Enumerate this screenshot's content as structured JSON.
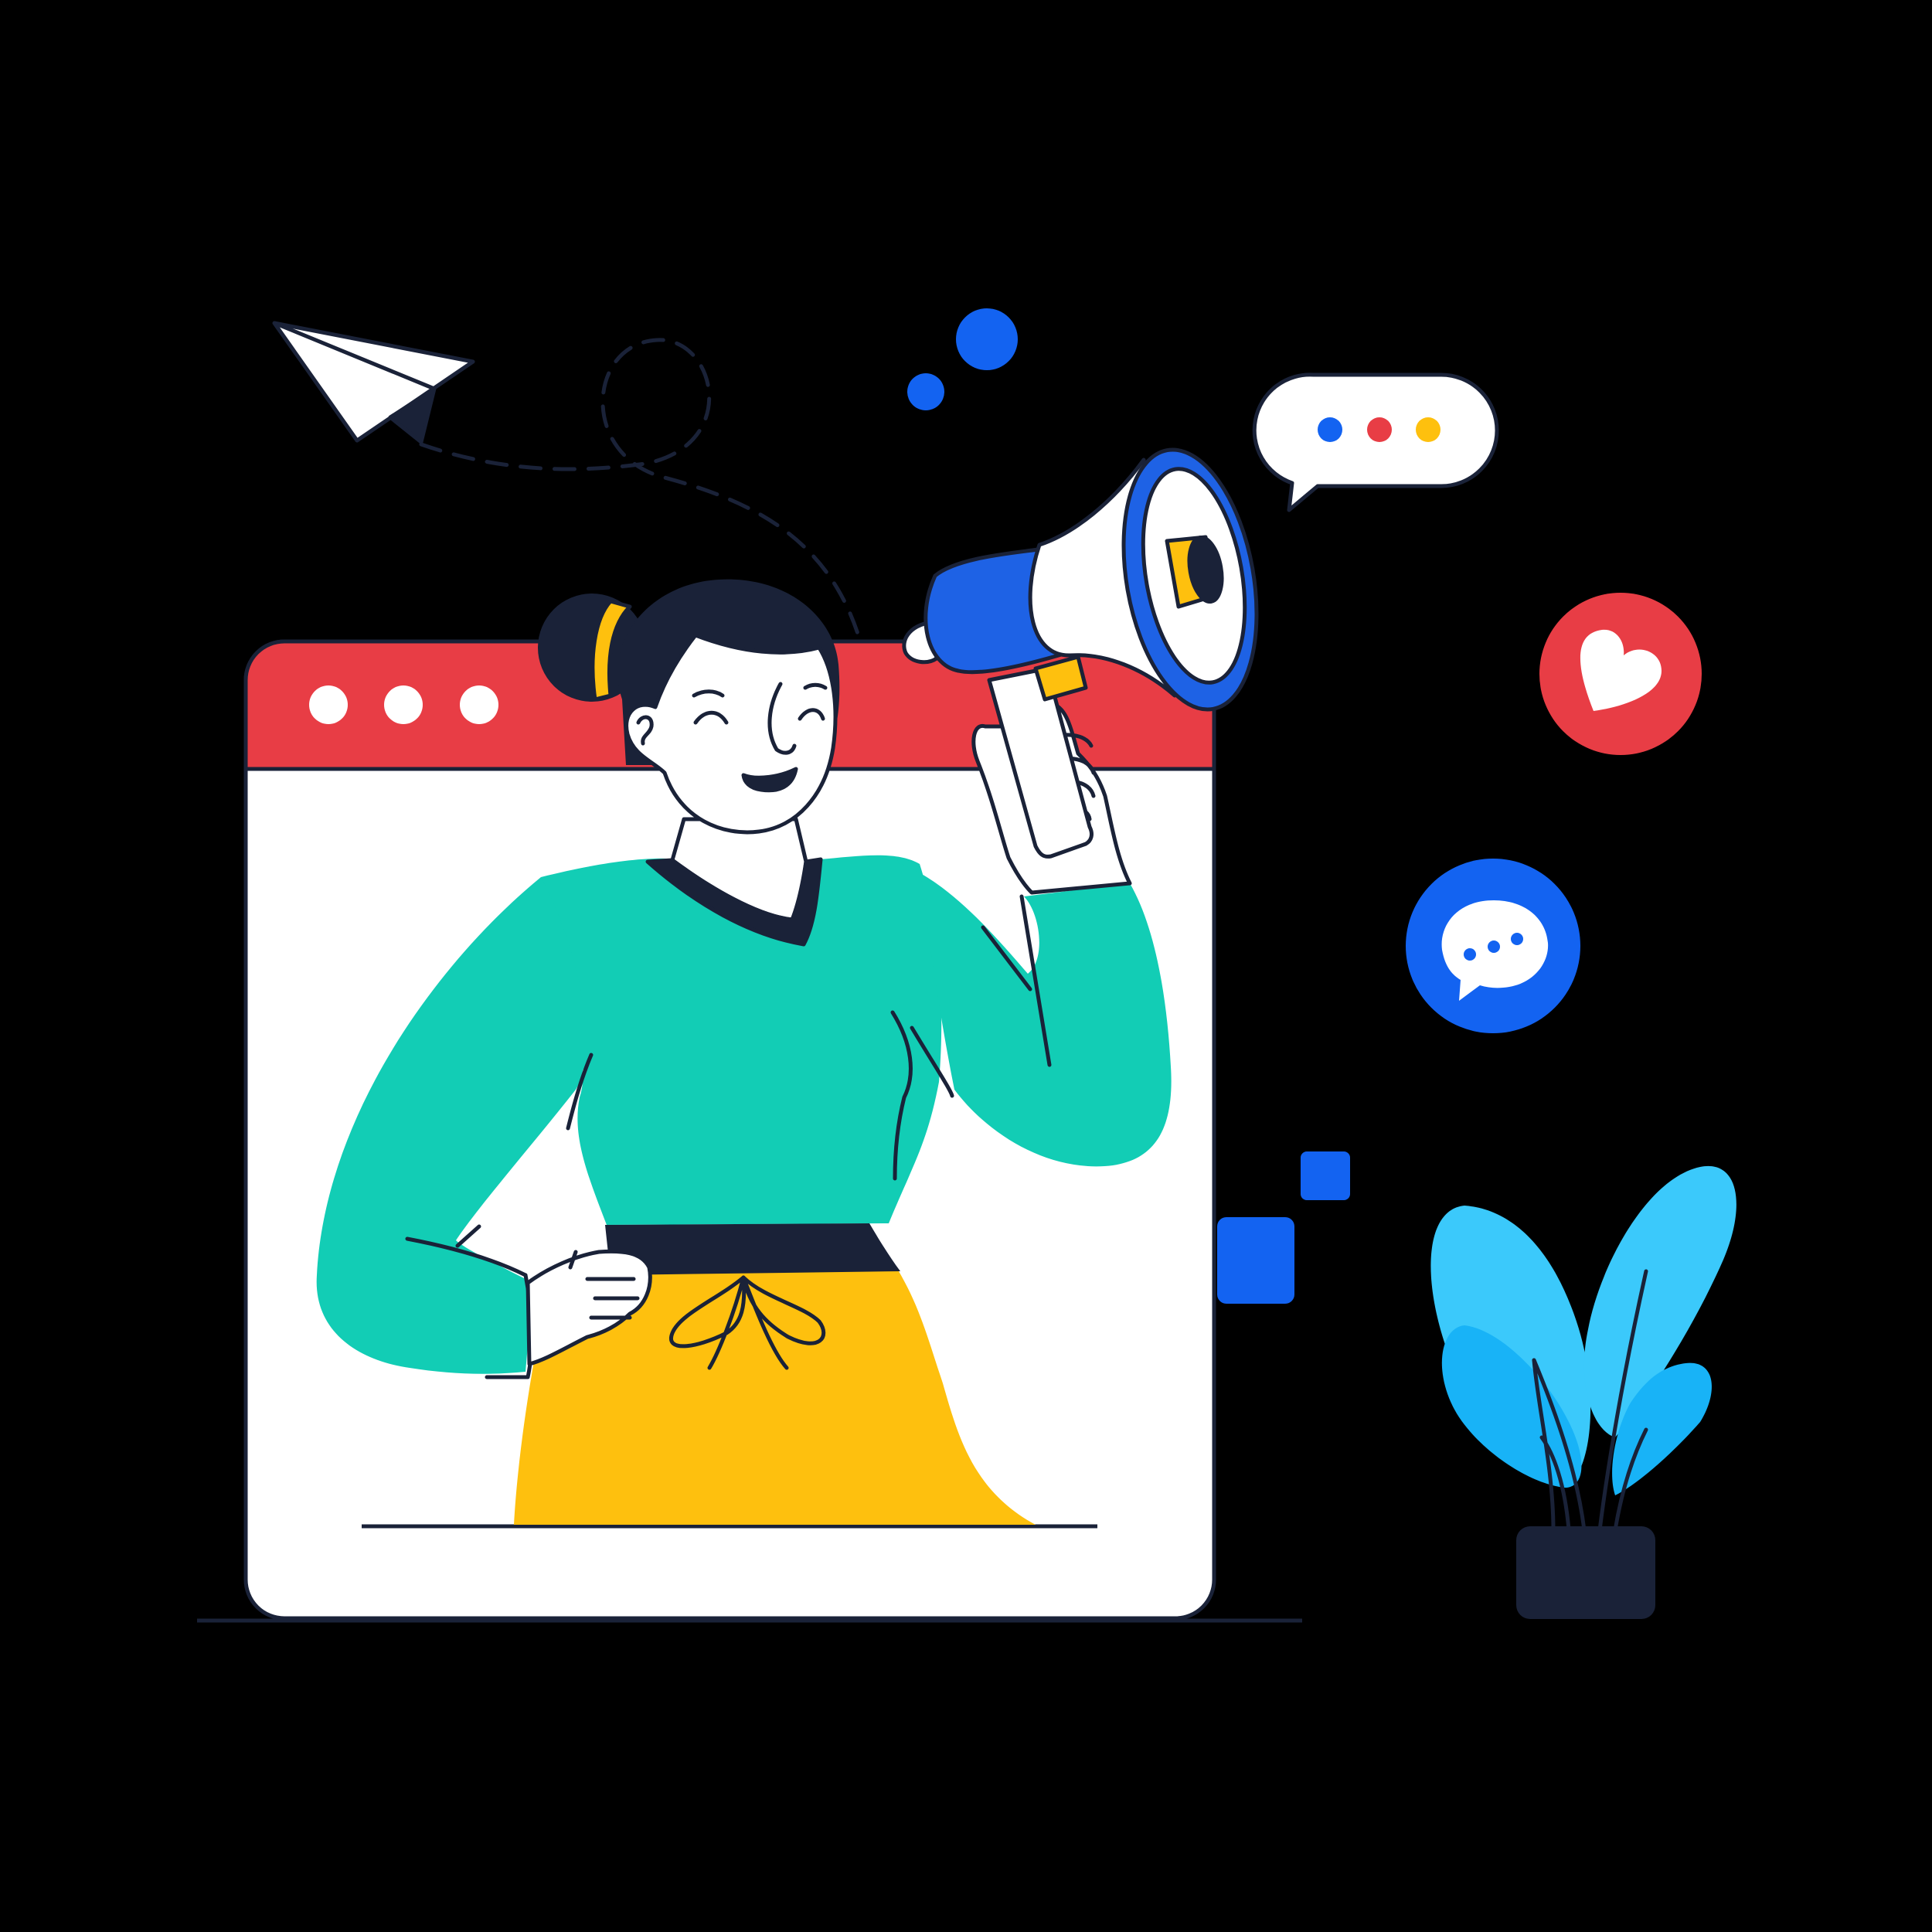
{
  "colors": {
    "background": "#000000",
    "outline": "#1a2238",
    "window_bar": "#e83d45",
    "window_body": "#ffffff",
    "shirt": "#12cdb5",
    "skirt": "#fec00e",
    "waistband": "#1a2238",
    "hair": "#1a2238",
    "hair_tie": "#fec00e",
    "skin": "#ffffff",
    "megaphone_blue": "#1e62e5",
    "megaphone_inner": "#ffffff",
    "megaphone_yellow": "#fec00e",
    "accent_blue": "#1363f1",
    "heart_badge": "#e83d45",
    "chat_badge": "#1363f1",
    "leaf_light": "#3bc9fb",
    "leaf_mid": "#18b3f7",
    "pot": "#1a2238",
    "dot_blue": "#1363f1",
    "dot_red": "#e83d45",
    "dot_yellow": "#fec00e"
  },
  "icons": {
    "paper_plane": "paper-plane-icon",
    "speech_bubble": "speech-bubble-icon",
    "heart": "heart-icon",
    "chat": "chat-icon",
    "megaphone": "megaphone-icon",
    "plant": "plant-icon"
  }
}
